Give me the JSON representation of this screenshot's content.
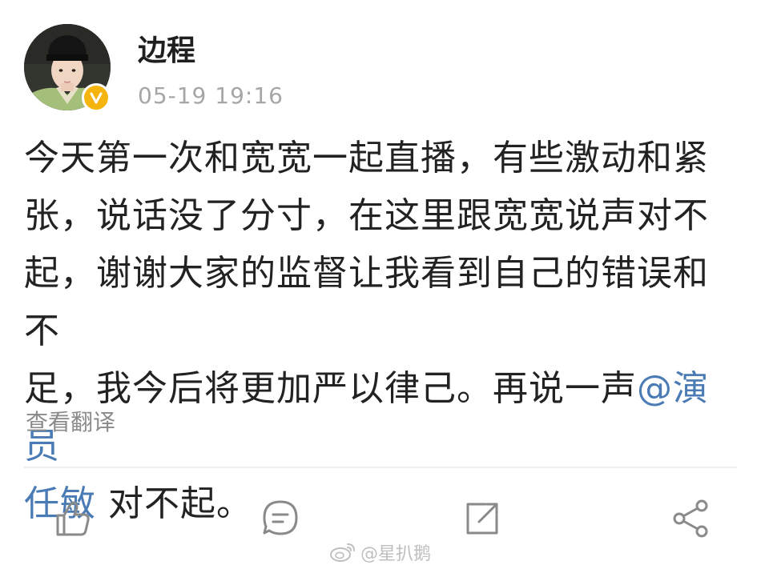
{
  "post": {
    "author": "边程",
    "timestamp": "05-19 19:16",
    "body": {
      "line1": "今天第一次和宽宽一起直播，有些激动和紧",
      "line2": "张，说话没了分寸，在这里跟宽宽说声对不",
      "line3": "起，谢谢大家的监督让我看到自己的错误和不",
      "line4_text": "足，我今后将更加严以律己。再说一声",
      "mention_part1": "@演员",
      "mention_part2": "任敏",
      "line5_text": " 对不起。"
    },
    "translate_label": "查看翻译"
  },
  "actions": {
    "like_icon": "thumbs-up-icon",
    "comment_icon": "comment-icon",
    "repost_icon": "repost-icon",
    "share_icon": "share-icon"
  },
  "watermark": {
    "text": "@星扒鹅",
    "icon": "weibo-logo-icon"
  },
  "colors": {
    "text": "#222222",
    "timestamp": "#a6a6a6",
    "mention": "#4a7bb5",
    "verified_badge": "#f6b40e",
    "icon": "#8a8a8a"
  }
}
